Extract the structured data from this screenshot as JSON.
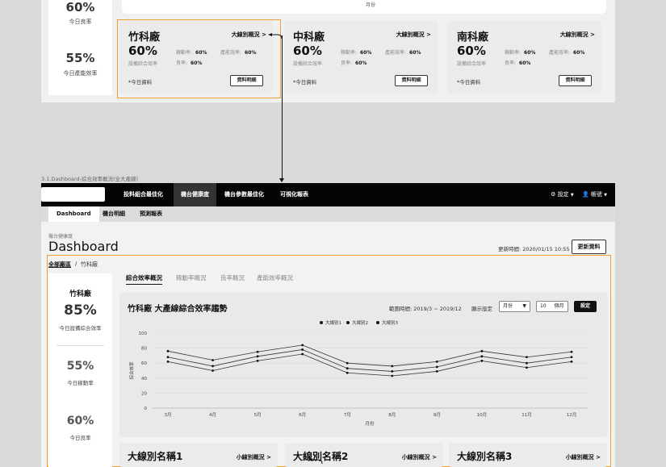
{
  "top_section": {
    "chart_x_label": "月份",
    "left_card": {
      "stat1_value": "60%",
      "stat1_label": "今日良率",
      "stat2_value": "55%",
      "stat2_label": "今日產能效率"
    },
    "factories": [
      {
        "name": "竹科廠",
        "link": "大線別概況 >",
        "pct": "60%",
        "pct_label": "設備綜合效率",
        "k1": "稼動率:",
        "v1": "60%",
        "k2": "產能效率:",
        "v2": "60%",
        "k3": "良率:",
        "v3": "60%",
        "note": "*今日資料",
        "btn": "資料明細"
      },
      {
        "name": "中科廠",
        "link": "大線別概況 >",
        "pct": "60%",
        "pct_label": "設備綜合效率",
        "k1": "稼動率:",
        "v1": "60%",
        "k2": "產能效率:",
        "v2": "60%",
        "k3": "良率:",
        "v3": "60%",
        "note": "*今日資料",
        "btn": "資料明細"
      },
      {
        "name": "南科廠",
        "link": "大線別概況 >",
        "pct": "60%",
        "pct_label": "設備綜合效率",
        "k1": "稼動率:",
        "v1": "60%",
        "k2": "產能效率:",
        "v2": "60%",
        "k3": "良率:",
        "v3": "60%",
        "note": "*今日資料",
        "btn": "資料明細"
      }
    ]
  },
  "frame_label": "3.1.Dashboard-綜合效率概況(全大產線)",
  "navbar": {
    "items": [
      "投料組合最佳化",
      "機台健康度",
      "機台參數最佳化",
      "可視化報表"
    ],
    "active_index": 1,
    "settings": "設定",
    "account": "帳號"
  },
  "subnav": {
    "items": [
      "Dashboard",
      "機台明細",
      "預測報表"
    ],
    "active_index": 0
  },
  "page": {
    "crumb_top": "機台健康度",
    "title": "Dashboard",
    "update_time": "更新時間: 2020/01/15 10:55",
    "update_button": "更新資料",
    "breadcrumb_all": "全部廠區",
    "breadcrumb_sep": "/",
    "breadcrumb_current": "竹科廠"
  },
  "stats": {
    "name": "竹科廠",
    "stat1_value": "85%",
    "stat1_label": "今日設備綜合效率",
    "stat2_value": "55%",
    "stat2_label": "今日稼動率",
    "stat3_value": "60%",
    "stat3_label": "今日良率"
  },
  "tabs": [
    "綜合效率概況",
    "稼動率概況",
    "良率概況",
    "產能效率概況"
  ],
  "chart_panel": {
    "range_text": "範圍時間: 2019/3 ~ 2019/12",
    "display_label": "顯示設定",
    "period_select": "月份",
    "months_value": "10",
    "months_unit": "個月",
    "set_button": "設定"
  },
  "chart_data": {
    "type": "line",
    "title": "竹科廠 大產線綜合效率趨勢",
    "xlabel": "月份",
    "ylabel": "綜合效率",
    "ylim": [
      0,
      100
    ],
    "yticks": [
      0,
      20,
      40,
      60,
      80,
      100
    ],
    "legend_position": "top",
    "grid": "horizontal",
    "categories": [
      "3月",
      "4月",
      "5月",
      "6月",
      "7月",
      "8月",
      "9月",
      "10月",
      "11月",
      "12月"
    ],
    "series": [
      {
        "name": "大線別1",
        "values": [
          76,
          64,
          75,
          84,
          60,
          56,
          62,
          76,
          68,
          75
        ]
      },
      {
        "name": "大線別2",
        "values": [
          68,
          56,
          69,
          78,
          53,
          49,
          55,
          69,
          60,
          68
        ]
      },
      {
        "name": "大線別3",
        "values": [
          62,
          50,
          63,
          72,
          47,
          43,
          49,
          63,
          54,
          62
        ]
      }
    ]
  },
  "line_cards": [
    {
      "name": "大線別名稱1",
      "link": "小線別概況 >"
    },
    {
      "name": "大線別名稱2",
      "link": "小線別概況 >"
    },
    {
      "name": "大線別名稱3",
      "link": "小線別概況 >"
    }
  ]
}
